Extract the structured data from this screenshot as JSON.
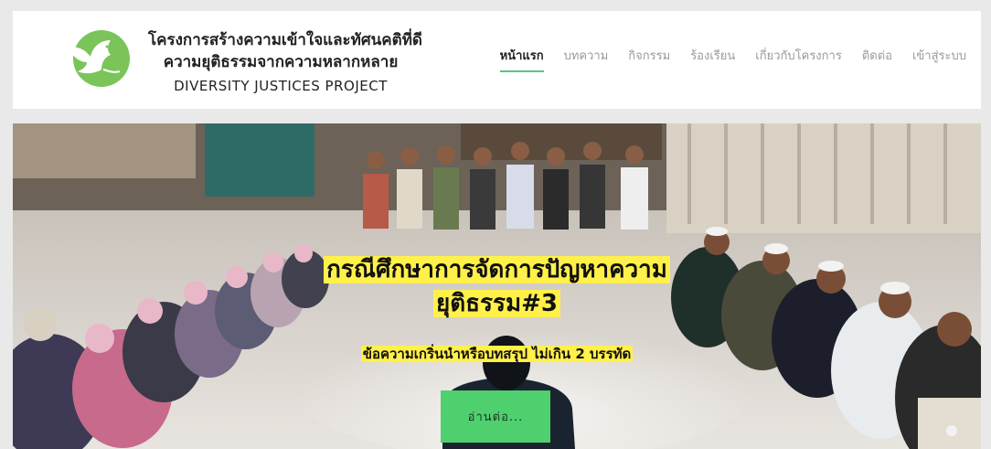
{
  "brand": {
    "title_line1": "โครงการสร้างความเข้าใจและทัศนคติที่ดี",
    "title_line2": "ความยุติธรรมจากความหลากหลาย",
    "title_en": "DIVERSITY JUSTICES PROJECT",
    "logo_icon": "dove-icon",
    "logo_color": "#7ac45a"
  },
  "nav": {
    "items": [
      {
        "label": "หน้าแรก",
        "active": true
      },
      {
        "label": "บทความ",
        "active": false
      },
      {
        "label": "กิจกรรม",
        "active": false
      },
      {
        "label": "ร้องเรียน",
        "active": false
      },
      {
        "label": "เกี่ยวกับโครงการ",
        "active": false
      },
      {
        "label": "ติดต่อ",
        "active": false
      },
      {
        "label": "เข้าสู่ระบบ",
        "active": false
      }
    ],
    "active_underline_color": "#58c77a"
  },
  "hero": {
    "title": "กรณีศึกษาการจัดการปัญหาความยุติธรรม#3",
    "subtitle": "ข้อความเกริ่นนำหรือบทสรุป ไม่เกิน 2 บรรทัด",
    "cta_label": "อ่านต่อ...",
    "highlight_color": "#fff04a",
    "cta_color": "#4fd06e"
  }
}
